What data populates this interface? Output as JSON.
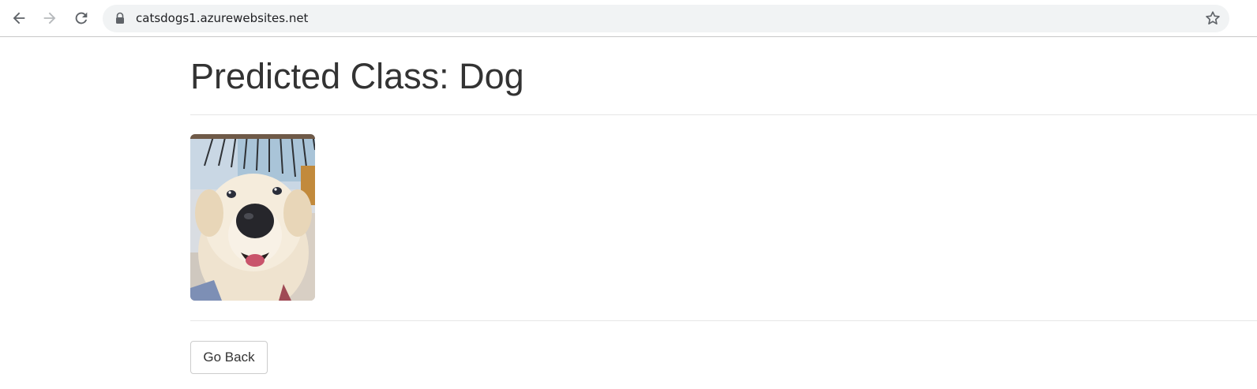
{
  "browser": {
    "url": "catsdogs1.azurewebsites.net",
    "icons": [
      "back-arrow-icon",
      "forward-arrow-icon",
      "reload-icon",
      "lock-icon",
      "bookmark-star-icon"
    ]
  },
  "page": {
    "heading": "Predicted Class: Dog",
    "image_subject": "golden retriever dog photo",
    "back_button_label": "Go Back"
  },
  "colors": {
    "text": "#333333",
    "omnibox_bg": "#f1f3f4",
    "divider": "#e6e6e6",
    "button_border": "#cccccc"
  }
}
